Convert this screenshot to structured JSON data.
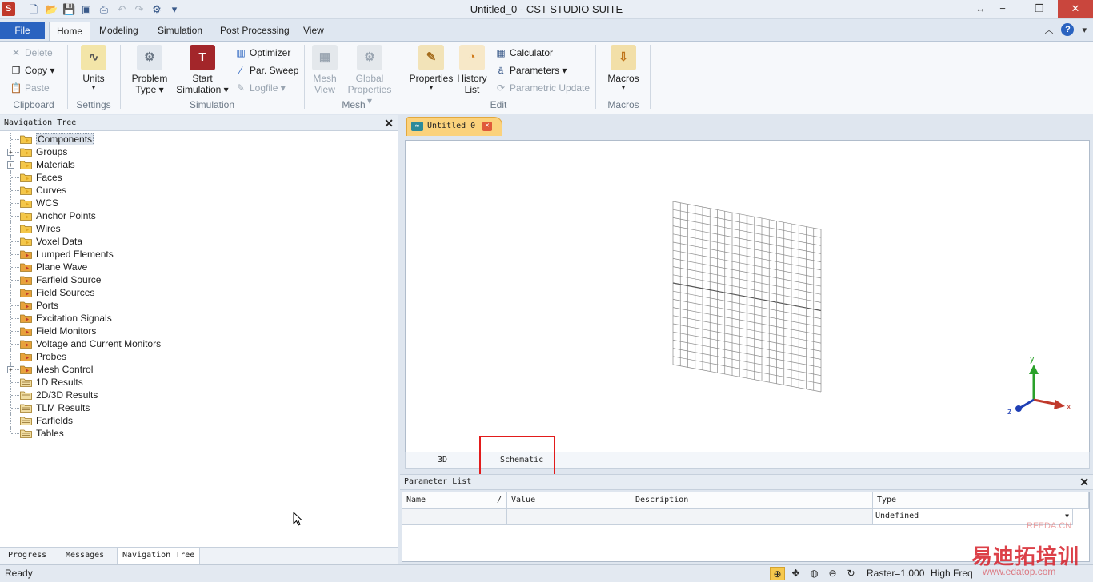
{
  "window": {
    "title": "Untitled_0 - CST STUDIO SUITE",
    "logo": "S",
    "restore_symbol": "↔",
    "minimize": "−",
    "maximize": "❐",
    "close": "✕"
  },
  "ribbon_tabs": {
    "file": "File",
    "home": "Home",
    "modeling": "Modeling",
    "simulation": "Simulation",
    "post_processing": "Post Processing",
    "view": "View"
  },
  "clipboard": {
    "delete": "Delete",
    "copy": "Copy",
    "paste": "Paste",
    "label": "Clipboard"
  },
  "settings": {
    "units": "Units",
    "label": "Settings"
  },
  "simulation_group": {
    "problem_type_1": "Problem",
    "problem_type_2": "Type",
    "start_sim_1": "Start",
    "start_sim_2": "Simulation",
    "optimizer": "Optimizer",
    "par_sweep": "Par. Sweep",
    "logfile": "Logfile",
    "label": "Simulation"
  },
  "mesh_group": {
    "mesh_view_1": "Mesh",
    "mesh_view_2": "View",
    "global_props_1": "Global",
    "global_props_2": "Properties",
    "label": "Mesh"
  },
  "edit_group": {
    "properties": "Properties",
    "history_1": "History",
    "history_2": "List",
    "calculator": "Calculator",
    "parameters": "Parameters",
    "parametric_update": "Parametric Update",
    "label": "Edit"
  },
  "macros_group": {
    "macros": "Macros",
    "label": "Macros"
  },
  "nav_tree": {
    "title": "Navigation Tree",
    "items": [
      {
        "label": "Components",
        "expander": false,
        "icon": "yellow",
        "selected": true
      },
      {
        "label": "Groups",
        "expander": true,
        "icon": "yellow"
      },
      {
        "label": "Materials",
        "expander": true,
        "icon": "yellow"
      },
      {
        "label": "Faces",
        "expander": false,
        "icon": "yellow"
      },
      {
        "label": "Curves",
        "expander": false,
        "icon": "yellow"
      },
      {
        "label": "WCS",
        "expander": false,
        "icon": "yellow"
      },
      {
        "label": "Anchor Points",
        "expander": false,
        "icon": "yellow"
      },
      {
        "label": "Wires",
        "expander": false,
        "icon": "yellow"
      },
      {
        "label": "Voxel Data",
        "expander": false,
        "icon": "yellow"
      },
      {
        "label": "Lumped Elements",
        "expander": false,
        "icon": "red"
      },
      {
        "label": "Plane Wave",
        "expander": false,
        "icon": "red"
      },
      {
        "label": "Farfield Source",
        "expander": false,
        "icon": "red"
      },
      {
        "label": "Field Sources",
        "expander": false,
        "icon": "red"
      },
      {
        "label": "Ports",
        "expander": false,
        "icon": "red"
      },
      {
        "label": "Excitation Signals",
        "expander": false,
        "icon": "red"
      },
      {
        "label": "Field Monitors",
        "expander": false,
        "icon": "red"
      },
      {
        "label": "Voltage and Current Monitors",
        "expander": false,
        "icon": "red"
      },
      {
        "label": "Probes",
        "expander": false,
        "icon": "red"
      },
      {
        "label": "Mesh Control",
        "expander": true,
        "icon": "red"
      },
      {
        "label": "1D Results",
        "expander": false,
        "icon": "plain"
      },
      {
        "label": "2D/3D Results",
        "expander": false,
        "icon": "plain"
      },
      {
        "label": "TLM Results",
        "expander": false,
        "icon": "plain"
      },
      {
        "label": "Farfields",
        "expander": false,
        "icon": "plain"
      },
      {
        "label": "Tables",
        "expander": false,
        "icon": "plain"
      }
    ]
  },
  "bottom_tabs": {
    "progress": "Progress",
    "messages": "Messages",
    "navigation_tree": "Navigation Tree"
  },
  "document": {
    "tab_label": "Untitled_0",
    "view_3d": "3D",
    "view_schematic": "Schematic"
  },
  "axes": {
    "x": "x",
    "y": "y",
    "z": "z"
  },
  "parameter_list": {
    "title": "Parameter List",
    "columns": {
      "name": "Name",
      "value": "Value",
      "description": "Description",
      "type": "Type"
    },
    "sort_indicator": "/",
    "new_row_type": "Undefined"
  },
  "status": {
    "ready": "Ready",
    "raster": "Raster=1.000",
    "freq": "High Freq"
  },
  "watermark": {
    "brand": "易迪拓培训",
    "site": "www.edatop.com",
    "small": "RFEDA.CN"
  },
  "colors": {
    "accent": "#2a63c0",
    "highlight_box": "#e21b1b",
    "doc_tab": "#fbd27c"
  }
}
